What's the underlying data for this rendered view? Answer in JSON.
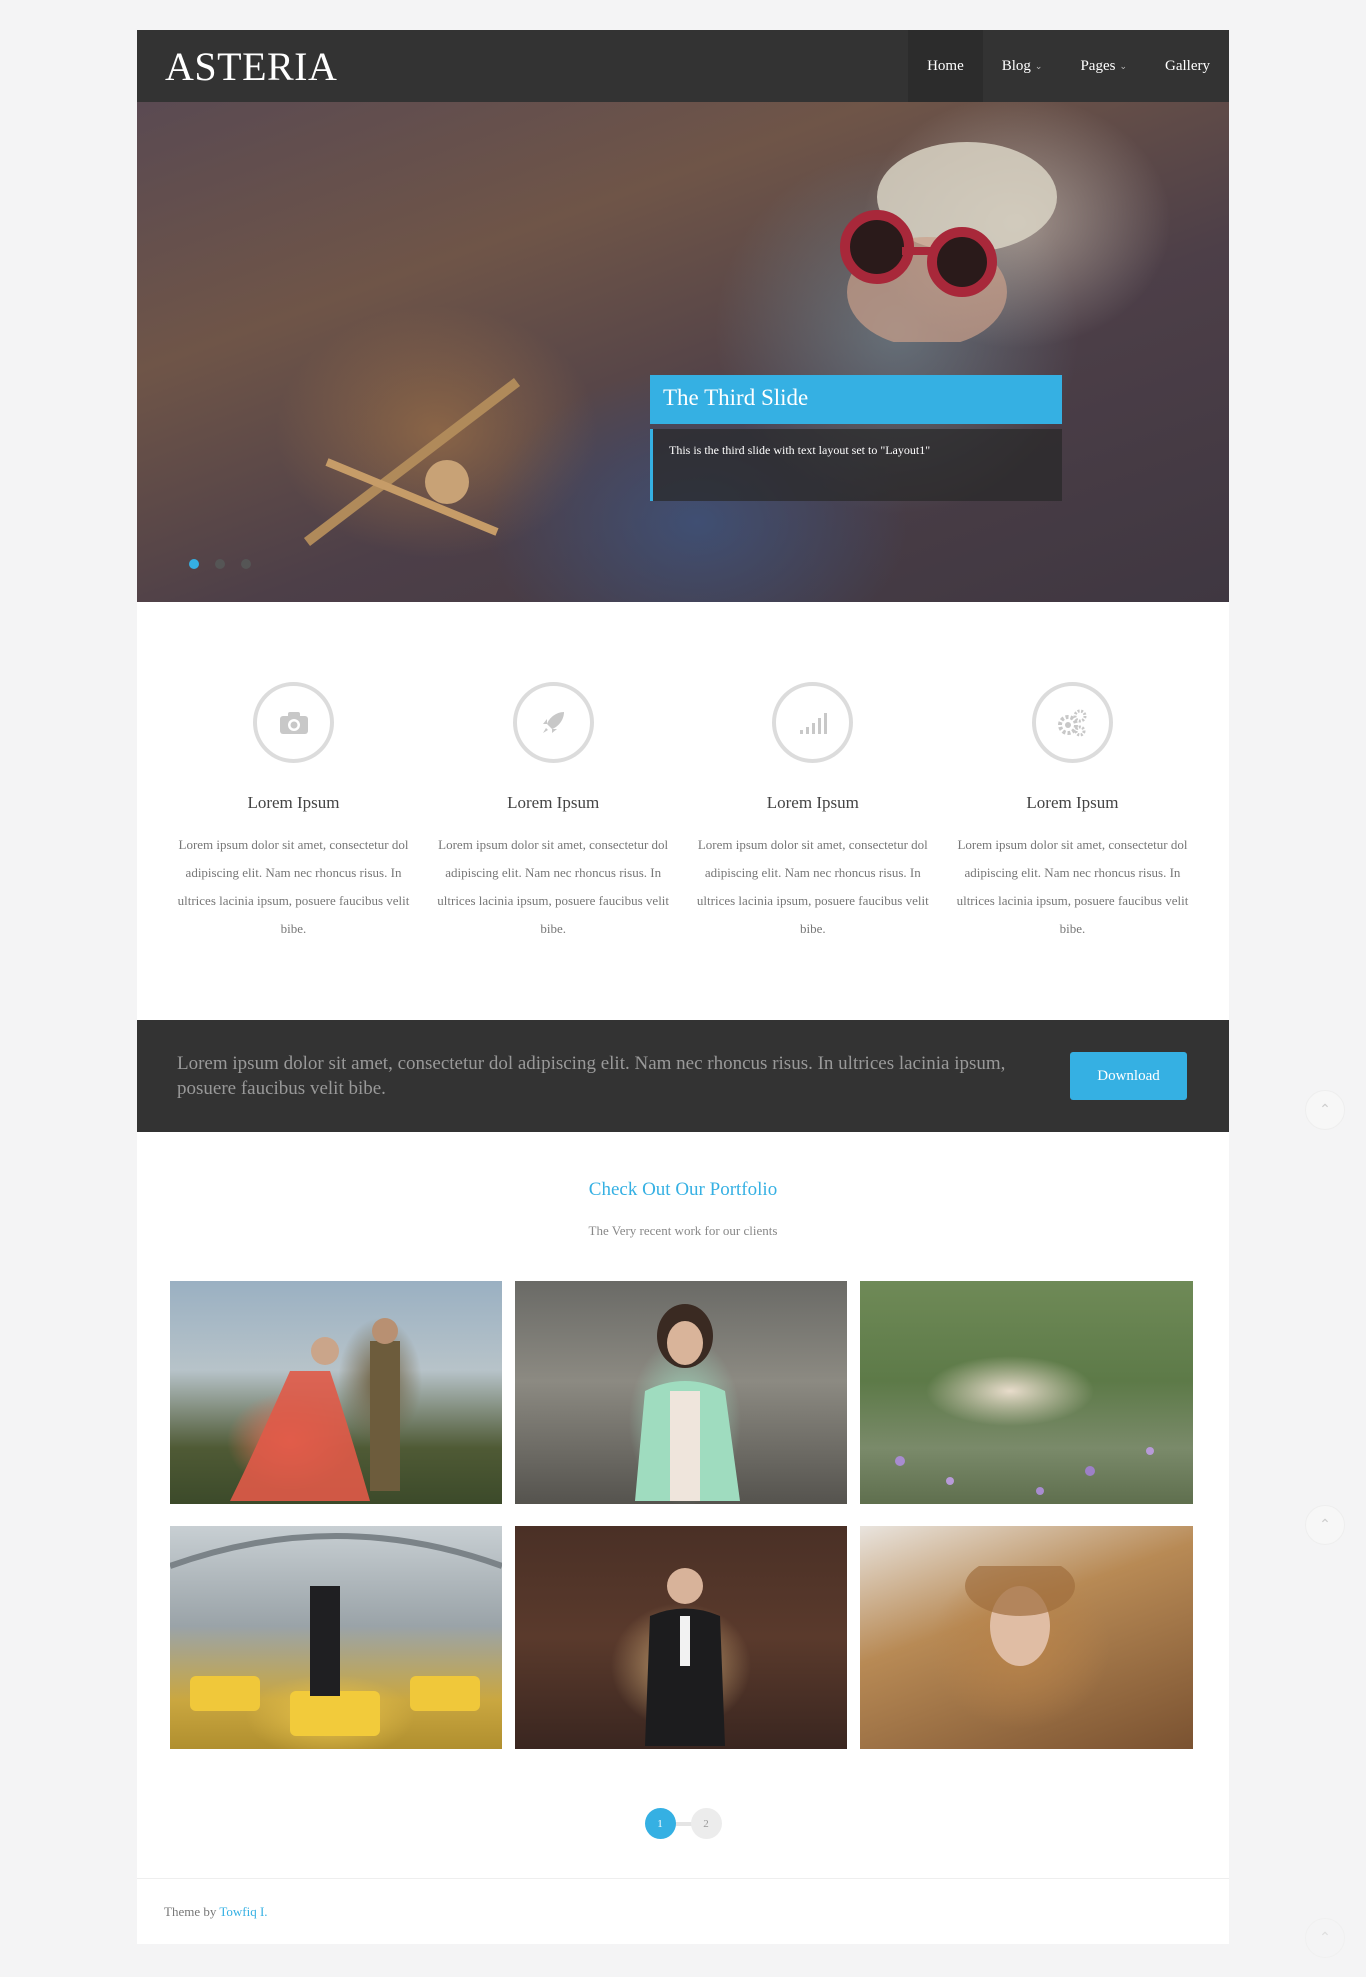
{
  "brand": {
    "logo": "ASTERIA",
    "accent": "#35b0e3",
    "dark": "#333333"
  },
  "nav": {
    "items": [
      {
        "label": "Home",
        "active": true,
        "dropdown": false
      },
      {
        "label": "Blog",
        "active": false,
        "dropdown": true
      },
      {
        "label": "Pages",
        "active": false,
        "dropdown": true
      },
      {
        "label": "Gallery",
        "active": false,
        "dropdown": false
      }
    ]
  },
  "slider": {
    "caption_title": "The Third Slide",
    "caption_text": "This is the third slide with text layout set to \"Layout1\"",
    "dots_count": 3,
    "active_dot": 1
  },
  "features": [
    {
      "icon": "camera-icon",
      "title": "Lorem Ipsum",
      "text": "Lorem ipsum dolor sit amet, consectetur dol adipiscing elit. Nam nec rhoncus risus. In ultrices lacinia ipsum, posuere faucibus velit bibe."
    },
    {
      "icon": "rocket-icon",
      "title": "Lorem Ipsum",
      "text": "Lorem ipsum dolor sit amet, consectetur dol adipiscing elit. Nam nec rhoncus risus. In ultrices lacinia ipsum, posuere faucibus velit bibe."
    },
    {
      "icon": "signal-icon",
      "title": "Lorem Ipsum",
      "text": "Lorem ipsum dolor sit amet, consectetur dol adipiscing elit. Nam nec rhoncus risus. In ultrices lacinia ipsum, posuere faucibus velit bibe."
    },
    {
      "icon": "gears-icon",
      "title": "Lorem Ipsum",
      "text": "Lorem ipsum dolor sit amet, consectetur dol adipiscing elit. Nam nec rhoncus risus. In ultrices lacinia ipsum, posuere faucibus velit bibe."
    }
  ],
  "promo": {
    "text": "Lorem ipsum dolor sit amet, consectetur dol adipiscing elit. Nam nec rhoncus risus. In ultrices lacinia ipsum, posuere faucibus velit bibe.",
    "button_label": "Download"
  },
  "portfolio": {
    "title": "Check Out Our Portfolio",
    "subtitle": "The Very recent work for our clients",
    "pages": [
      "1",
      "2"
    ],
    "active_page": "1"
  },
  "footer": {
    "prefix": "Theme by ",
    "author": "Towfiq I."
  }
}
